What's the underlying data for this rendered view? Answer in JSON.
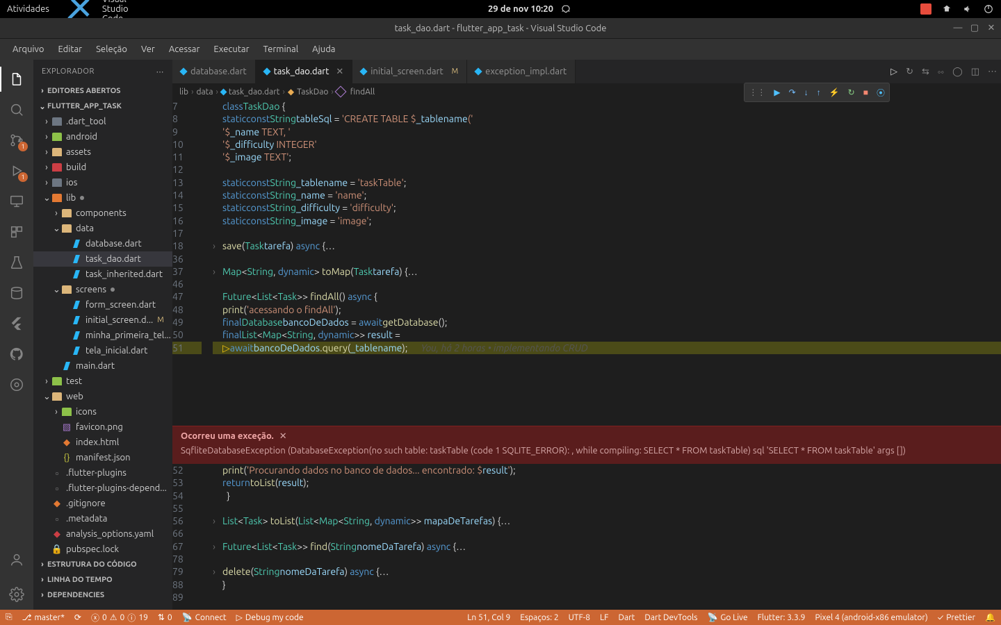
{
  "sysbar": {
    "activities": "Atividades",
    "app_name": "Visual Studio Code",
    "datetime": "29 de nov  10:20"
  },
  "window_title": "task_dao.dart - flutter_app_task - Visual Studio Code",
  "menu": [
    "Arquivo",
    "Editar",
    "Seleção",
    "Ver",
    "Acessar",
    "Executar",
    "Terminal",
    "Ajuda"
  ],
  "activitybar": {
    "scm_badge": "1",
    "debug_badge": "1"
  },
  "sidebar": {
    "title": "EXPLORADOR",
    "sections": {
      "editors": "EDITORES ABERTOS",
      "project": "FLUTTER_APP_TASK",
      "outline": "ESTRUTURA DO CÓDIGO",
      "timeline": "LINHA DO TEMPO",
      "deps": "DEPENDENCIES"
    },
    "tree": [
      {
        "label": ".dart_tool",
        "type": "folder-grey",
        "indent": 0
      },
      {
        "label": "android",
        "type": "folder-green",
        "indent": 0
      },
      {
        "label": "assets",
        "type": "folder-yellow",
        "indent": 0
      },
      {
        "label": "build",
        "type": "folder-red",
        "indent": 0
      },
      {
        "label": "ios",
        "type": "folder-grey",
        "indent": 0
      },
      {
        "label": "lib",
        "type": "folder-orange",
        "indent": 0,
        "open": true,
        "dot": true
      },
      {
        "label": "components",
        "type": "folder-yellow",
        "indent": 1
      },
      {
        "label": "data",
        "type": "folder-yellow",
        "indent": 1,
        "open": true
      },
      {
        "label": "database.dart",
        "type": "dart",
        "indent": 2
      },
      {
        "label": "task_dao.dart",
        "type": "dart",
        "indent": 2,
        "current": true
      },
      {
        "label": "task_inherited.dart",
        "type": "dart",
        "indent": 2
      },
      {
        "label": "screens",
        "type": "folder-yellow",
        "indent": 1,
        "open": true,
        "dot": true
      },
      {
        "label": "form_screen.dart",
        "type": "dart",
        "indent": 2
      },
      {
        "label": "initial_screen.d...",
        "type": "dart",
        "indent": 2,
        "mod": "M"
      },
      {
        "label": "minha_primeira_tel...",
        "type": "dart",
        "indent": 2
      },
      {
        "label": "tela_inicial.dart",
        "type": "dart",
        "indent": 2
      },
      {
        "label": "main.dart",
        "type": "dart",
        "indent": 1
      },
      {
        "label": "test",
        "type": "folder-green",
        "indent": 0
      },
      {
        "label": "web",
        "type": "folder-yellow",
        "indent": 0,
        "open": true
      },
      {
        "label": "icons",
        "type": "folder-green",
        "indent": 1
      },
      {
        "label": "favicon.png",
        "type": "img",
        "indent": 1
      },
      {
        "label": "index.html",
        "type": "html",
        "indent": 1
      },
      {
        "label": "manifest.json",
        "type": "json",
        "indent": 1
      },
      {
        "label": ".flutter-plugins",
        "type": "file",
        "indent": 0
      },
      {
        "label": ".flutter-plugins-depend...",
        "type": "file",
        "indent": 0
      },
      {
        "label": ".gitignore",
        "type": "git",
        "indent": 0
      },
      {
        "label": ".metadata",
        "type": "file",
        "indent": 0
      },
      {
        "label": "analysis_options.yaml",
        "type": "yaml",
        "indent": 0
      },
      {
        "label": "pubspec.lock",
        "type": "lock",
        "indent": 0
      }
    ]
  },
  "tabs": [
    {
      "label": "database.dart"
    },
    {
      "label": "task_dao.dart",
      "active": true,
      "close": true
    },
    {
      "label": "initial_screen.dart",
      "mod": "M"
    },
    {
      "label": "exception_impl.dart"
    }
  ],
  "breadcrumb": [
    "lib",
    "data",
    "task_dao.dart",
    "TaskDao",
    "findAll"
  ],
  "code": {
    "lines": [
      {
        "n": 7,
        "html": "<span class='kw'>class</span> <span class='ty'>TaskDao</span> {"
      },
      {
        "n": 8,
        "html": "  <span class='kw'>static</span> <span class='kw'>const</span> <span class='ty'>String</span> <span class='va'>tableSql</span> = <span class='st'>'CREATE TABLE $</span><span class='va'>_tablename</span><span class='st'>('</span>"
      },
      {
        "n": 9,
        "html": "      <span class='st'>'$</span><span class='va'>_name</span><span class='st'> TEXT, '</span>"
      },
      {
        "n": 10,
        "html": "      <span class='st'>'$</span><span class='va'>_difficulty</span><span class='st'> INTEGER'</span>"
      },
      {
        "n": 11,
        "html": "      <span class='st'>'$</span><span class='va'>_image</span><span class='st'> TEXT'</span>;"
      },
      {
        "n": 12,
        "html": ""
      },
      {
        "n": 13,
        "html": "  <span class='kw'>static</span> <span class='kw'>const</span> <span class='ty'>String</span> <span class='va'>_tablename</span> = <span class='st'>'taskTable'</span>;"
      },
      {
        "n": 14,
        "html": "  <span class='kw'>static</span> <span class='kw'>const</span> <span class='ty'>String</span> <span class='va'>_name</span> = <span class='st'>'name'</span>;"
      },
      {
        "n": 15,
        "html": "  <span class='kw'>static</span> <span class='kw'>const</span> <span class='ty'>String</span> <span class='va'>_difficulty</span> = <span class='st'>'difficulty'</span>;"
      },
      {
        "n": 16,
        "html": "  <span class='kw'>static</span> <span class='kw'>const</span> <span class='ty'>String</span> <span class='va'>_image</span> = <span class='st'>'image'</span>;"
      },
      {
        "n": 17,
        "html": ""
      },
      {
        "n": 18,
        "html": "  <span class='fn'>save</span>(<span class='ty'>Task</span> <span class='va'>tarefa</span>) <span class='kw'>async</span> {<span class='op'>…</span>",
        "fold": true
      },
      {
        "n": 36,
        "html": ""
      },
      {
        "n": 37,
        "html": "  <span class='ty'>Map</span>&lt;<span class='ty'>String</span>, <span class='kw'>dynamic</span>&gt; <span class='fn'>toMap</span>(<span class='ty'>Task</span> <span class='va'>tarefa</span>) {<span class='op'>…</span>",
        "fold": true
      },
      {
        "n": 46,
        "html": ""
      },
      {
        "n": 47,
        "html": "  <span class='ty'>Future</span>&lt;<span class='ty'>List</span>&lt;<span class='ty'>Task</span>&gt;&gt; <span class='fn'>findAll</span>() <span class='kw'>async</span> {"
      },
      {
        "n": 48,
        "html": "    <span class='fn'>print</span>(<span class='st'>'acessando o findAll'</span>);"
      },
      {
        "n": 49,
        "html": "    <span class='kw'>final</span> <span class='ty'>Database</span> <span class='va'>bancoDeDados</span> = <span class='kw'>await</span> <span class='fn'>getDatabase</span>();"
      },
      {
        "n": 50,
        "html": "    <span class='kw'>final</span> <span class='ty'>List</span>&lt;<span class='ty'>Map</span>&lt;<span class='ty'>String</span>, <span class='kw'>dynamic</span>&gt;&gt; <span class='va'>result</span> ="
      },
      {
        "n": 51,
        "html": "      <span style='color:#f1c40f'>▷</span><span class='kw'>await</span> <span class='va'>bancoDeDados</span>.<span class='fn'>query</span>(<span class='va'>_tablename</span>);      <span class='gitlens'>You, há 2 horas • implementando CRUD</span>",
        "cur": true
      }
    ],
    "lines2": [
      {
        "n": 52,
        "html": "    <span class='fn'>print</span>(<span class='st'>'Procurando dados no banco de dados... encontrado: $</span><span class='va'>result</span><span class='st'>'</span>);"
      },
      {
        "n": 53,
        "html": "    <span class='kw'>return</span> <span class='fn'>toList</span>(<span class='va'>result</span>);"
      },
      {
        "n": 54,
        "html": "  }"
      },
      {
        "n": 55,
        "html": ""
      },
      {
        "n": 56,
        "html": "  <span class='ty'>List</span>&lt;<span class='ty'>Task</span>&gt; <span class='fn'>toList</span>(<span class='ty'>List</span>&lt;<span class='ty'>Map</span>&lt;<span class='ty'>String</span>, <span class='kw'>dynamic</span>&gt;&gt; <span class='va'>mapaDeTarefas</span>) {<span class='op'>…</span>",
        "fold": true
      },
      {
        "n": 66,
        "html": ""
      },
      {
        "n": 67,
        "html": "  <span class='ty'>Future</span>&lt;<span class='ty'>List</span>&lt;<span class='ty'>Task</span>&gt;&gt; <span class='fn'>find</span>(<span class='ty'>String</span> <span class='va'>nomeDaTarefa</span>) <span class='kw'>async</span> {<span class='op'>…</span>",
        "fold": true
      },
      {
        "n": 78,
        "html": ""
      },
      {
        "n": 79,
        "html": "  <span class='fn'>delete</span>(<span class='ty'>String</span> <span class='va'>nomeDaTarefa</span>) <span class='kw'>async</span> {<span class='op'>…</span>",
        "fold": true
      },
      {
        "n": 88,
        "html": "}"
      },
      {
        "n": 89,
        "html": ""
      }
    ]
  },
  "exception": {
    "title": "Ocorreu uma exceção.",
    "body": "SqfliteDatabaseException (DatabaseException(no such table: taskTable (code 1 SQLITE_ERROR): , while compiling: SELECT * FROM taskTable) sql 'SELECT * FROM taskTable' args [])"
  },
  "statusbar": {
    "branch": "master*",
    "sync": "",
    "problems": {
      "err": "0",
      "warn": "0",
      "info": "19"
    },
    "port": "0",
    "connect": "Connect",
    "debug_cfg": "Debug my code",
    "pos": "Ln 51, Col 9",
    "spaces": "Espaços: 2",
    "encoding": "UTF-8",
    "eol": "LF",
    "lang": "Dart",
    "devtools": "Dart DevTools",
    "golive": "Go Live",
    "flutter": "Flutter: 3.3.9",
    "device": "Pixel 4 (android-x86 emulator)",
    "prettier": "Prettier"
  }
}
